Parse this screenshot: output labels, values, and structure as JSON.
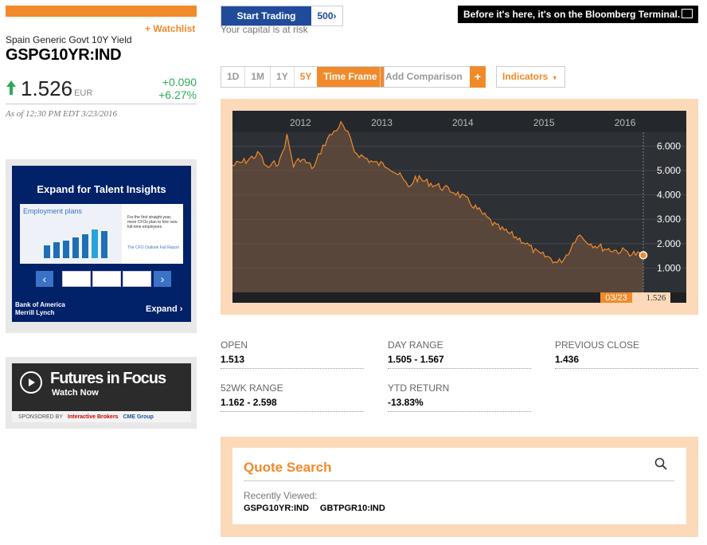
{
  "quote": {
    "watchlist_label": "+ Watchlist",
    "security_name": "Spain Generic Govt 10Y Yield",
    "ticker": "GSPG10YR:IND",
    "price": "1.526",
    "currency": "EUR",
    "change_abs": "+0.090",
    "change_pct": "+6.27%",
    "as_of": "As of 12:30 PM EDT 3/23/2016"
  },
  "ads": {
    "talent": {
      "title": "Expand for Talent Insights",
      "slide_heading": "Employment plans",
      "slide_caption": "For the first straight year, more CFOs plan to hire new full-time employees",
      "slide_link": "The CFO Outlook Full Report",
      "sponsor_line1": "Bank of America",
      "sponsor_line2": "Merrill Lynch",
      "expand_label": "Expand"
    },
    "futures": {
      "title": "Futures in Focus",
      "subtitle": "Watch Now",
      "sponsored_by": "SPONSORED BY",
      "sponsor1": "Interactive Brokers",
      "sponsor2": "CME Group"
    }
  },
  "header": {
    "start_trading": "Start Trading",
    "start_badge": "500",
    "capital_risk": "Your capital is at risk",
    "bloomberg_banner": "Before it's here, it's on the Bloomberg Terminal."
  },
  "toolbar": {
    "ranges": [
      "1D",
      "1M",
      "1Y",
      "5Y"
    ],
    "active_range": "5Y",
    "time_frame": "Time Frame",
    "add_comparison": "Add Comparison",
    "add_plus": "+",
    "indicators": "Indicators"
  },
  "chart_data": {
    "type": "area",
    "x_tick_labels": [
      "2012",
      "2013",
      "2014",
      "2015",
      "2016"
    ],
    "y_tick_labels": [
      "6.000",
      "5.000",
      "4.000",
      "3.000",
      "2.000",
      "1.000"
    ],
    "ylim": [
      0.0,
      6.8
    ],
    "series": [
      {
        "values": [
          {
            "x": "2011-03",
            "y": 5.2
          },
          {
            "x": "2011-05",
            "y": 5.4
          },
          {
            "x": "2011-07",
            "y": 5.7
          },
          {
            "x": "2011-08",
            "y": 5.1
          },
          {
            "x": "2011-10",
            "y": 5.4
          },
          {
            "x": "2011-11",
            "y": 6.4
          },
          {
            "x": "2011-12",
            "y": 5.2
          },
          {
            "x": "2012-01",
            "y": 5.5
          },
          {
            "x": "2012-03",
            "y": 5.1
          },
          {
            "x": "2012-04",
            "y": 5.8
          },
          {
            "x": "2012-05",
            "y": 6.3
          },
          {
            "x": "2012-06",
            "y": 6.6
          },
          {
            "x": "2012-07",
            "y": 6.9
          },
          {
            "x": "2012-08",
            "y": 6.5
          },
          {
            "x": "2012-09",
            "y": 5.8
          },
          {
            "x": "2012-10",
            "y": 5.6
          },
          {
            "x": "2012-12",
            "y": 5.3
          },
          {
            "x": "2013-02",
            "y": 5.2
          },
          {
            "x": "2013-04",
            "y": 4.7
          },
          {
            "x": "2013-05",
            "y": 4.3
          },
          {
            "x": "2013-06",
            "y": 4.7
          },
          {
            "x": "2013-08",
            "y": 4.5
          },
          {
            "x": "2013-10",
            "y": 4.3
          },
          {
            "x": "2013-12",
            "y": 4.1
          },
          {
            "x": "2014-02",
            "y": 3.7
          },
          {
            "x": "2014-04",
            "y": 3.2
          },
          {
            "x": "2014-06",
            "y": 2.7
          },
          {
            "x": "2014-08",
            "y": 2.4
          },
          {
            "x": "2014-10",
            "y": 2.1
          },
          {
            "x": "2014-12",
            "y": 1.6
          },
          {
            "x": "2015-02",
            "y": 1.4
          },
          {
            "x": "2015-03",
            "y": 1.2
          },
          {
            "x": "2015-04",
            "y": 1.4
          },
          {
            "x": "2015-05",
            "y": 1.8
          },
          {
            "x": "2015-06",
            "y": 2.4
          },
          {
            "x": "2015-07",
            "y": 2.2
          },
          {
            "x": "2015-08",
            "y": 2.0
          },
          {
            "x": "2015-10",
            "y": 1.8
          },
          {
            "x": "2015-12",
            "y": 1.7
          },
          {
            "x": "2016-01",
            "y": 1.7
          },
          {
            "x": "2016-02",
            "y": 1.6
          },
          {
            "x": "2016-03",
            "y": 1.526
          }
        ]
      }
    ],
    "last_label_date": "03/23",
    "last_label_value": "1.526",
    "line_color": "#f18a2a",
    "background": "#2d3035"
  },
  "stats": [
    {
      "label": "OPEN",
      "value": "1.513"
    },
    {
      "label": "DAY RANGE",
      "value": "1.505 - 1.567"
    },
    {
      "label": "PREVIOUS CLOSE",
      "value": "1.436"
    },
    {
      "label": "52WK RANGE",
      "value": "1.162 - 2.598"
    },
    {
      "label": "YTD RETURN",
      "value": "-13.83%"
    }
  ],
  "quote_search": {
    "title": "Quote Search",
    "recently_viewed": "Recently Viewed:",
    "items": [
      "GSPG10YR:IND",
      "GBTPGR10:IND"
    ]
  }
}
